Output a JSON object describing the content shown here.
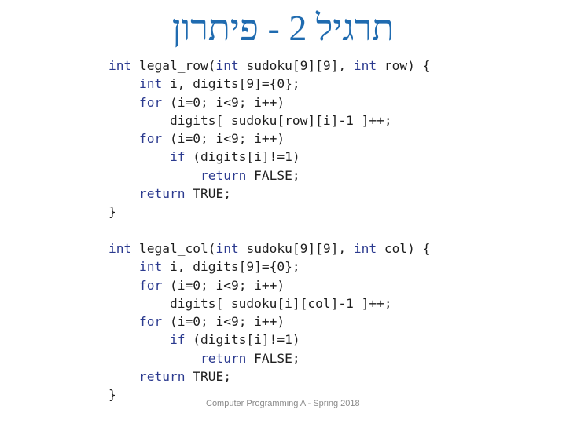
{
  "slide": {
    "title": "תרגיל 2 - פיתרון",
    "footer": "Computer Programming A - Spring 2018"
  },
  "code": {
    "lines": [
      [
        {
          "t": "int",
          "k": 1
        },
        {
          "t": " legal_row("
        },
        {
          "t": "int",
          "k": 1
        },
        {
          "t": " sudoku[9][9], "
        },
        {
          "t": "int",
          "k": 1
        },
        {
          "t": " row) {"
        }
      ],
      [
        {
          "t": "    "
        },
        {
          "t": "int",
          "k": 1
        },
        {
          "t": " i, digits[9]={0};"
        }
      ],
      [
        {
          "t": "    "
        },
        {
          "t": "for",
          "k": 1
        },
        {
          "t": " (i=0; i<9; i++)"
        }
      ],
      [
        {
          "t": "        digits[ sudoku[row][i]-1 ]++;"
        }
      ],
      [
        {
          "t": "    "
        },
        {
          "t": "for",
          "k": 1
        },
        {
          "t": " (i=0; i<9; i++)"
        }
      ],
      [
        {
          "t": "        "
        },
        {
          "t": "if",
          "k": 1
        },
        {
          "t": " (digits[i]!=1)"
        }
      ],
      [
        {
          "t": "            "
        },
        {
          "t": "return",
          "k": 1
        },
        {
          "t": " FALSE;"
        }
      ],
      [
        {
          "t": "    "
        },
        {
          "t": "return",
          "k": 1
        },
        {
          "t": " TRUE;"
        }
      ],
      [
        {
          "t": "}"
        }
      ],
      [
        {
          "t": ""
        }
      ],
      [
        {
          "t": "int",
          "k": 1
        },
        {
          "t": " legal_col("
        },
        {
          "t": "int",
          "k": 1
        },
        {
          "t": " sudoku[9][9], "
        },
        {
          "t": "int",
          "k": 1
        },
        {
          "t": " col) {"
        }
      ],
      [
        {
          "t": "    "
        },
        {
          "t": "int",
          "k": 1
        },
        {
          "t": " i, digits[9]={0};"
        }
      ],
      [
        {
          "t": "    "
        },
        {
          "t": "for",
          "k": 1
        },
        {
          "t": " (i=0; i<9; i++)"
        }
      ],
      [
        {
          "t": "        digits[ sudoku[i][col]-1 ]++;"
        }
      ],
      [
        {
          "t": "    "
        },
        {
          "t": "for",
          "k": 1
        },
        {
          "t": " (i=0; i<9; i++)"
        }
      ],
      [
        {
          "t": "        "
        },
        {
          "t": "if",
          "k": 1
        },
        {
          "t": " (digits[i]!=1)"
        }
      ],
      [
        {
          "t": "            "
        },
        {
          "t": "return",
          "k": 1
        },
        {
          "t": " FALSE;"
        }
      ],
      [
        {
          "t": "    "
        },
        {
          "t": "return",
          "k": 1
        },
        {
          "t": " TRUE;"
        }
      ],
      [
        {
          "t": "}"
        }
      ]
    ]
  },
  "colors": {
    "title": "#1f6bb0",
    "keyword": "#2b3a8f",
    "text": "#1e1e1e",
    "footer": "#8a8a8a"
  }
}
